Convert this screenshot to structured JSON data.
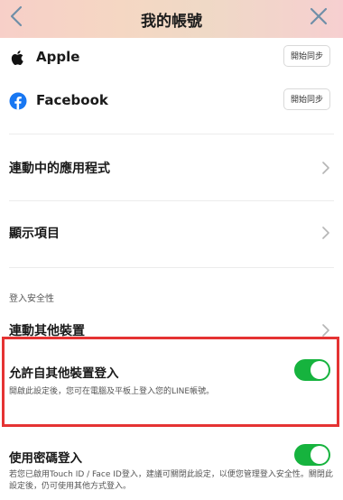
{
  "header": {
    "title": "我的帳號"
  },
  "accounts": [
    {
      "name": "Apple",
      "button": "開始同步"
    },
    {
      "name": "Facebook",
      "button": "開始同步"
    }
  ],
  "nav": {
    "linked_apps": "連動中的應用程式",
    "display_items": "顯示項目"
  },
  "login_security": {
    "section_label": "登入安全性",
    "link_devices": "連動其他裝置",
    "allow_login": {
      "title": "允許自其他裝置登入",
      "desc": "開啟此設定後，您可在電腦及平板上登入您的LINE帳號。",
      "enabled": true
    },
    "password_login": {
      "title": "使用密碼登入",
      "desc": "若您已啟用Touch ID / Face ID登入，建議可關閉此設定，以便您管理登入安全性。關閉此設定後，仍可使用其他方式登入。",
      "enabled": true
    }
  },
  "colors": {
    "toggle_on": "#16b33e",
    "highlight": "#e53333",
    "facebook": "#1877f2"
  }
}
